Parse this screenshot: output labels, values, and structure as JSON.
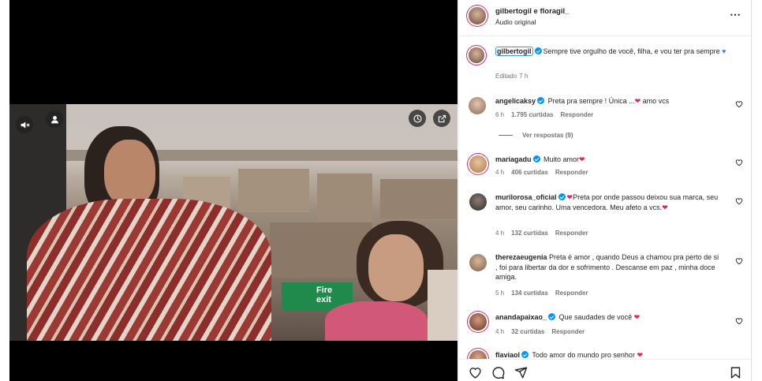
{
  "post": {
    "author_line": "gilbertogil e floragil_",
    "audio": "Áudio original",
    "more": "⋯"
  },
  "caption": {
    "user": "gilbertogil",
    "text": "Sempre tive orgulho de você, filha, e vou ter pra sempre",
    "edited": "Editado",
    "time": "7 h"
  },
  "video": {
    "sign_text_1": "Fire",
    "sign_text_2": "exit"
  },
  "comments": [
    {
      "user": "angelicaksy",
      "text": "Preta pra sempre ! Única ...",
      "text_after": "amo vcs",
      "time": "6 h",
      "likes": "1.795 curtidas",
      "reply": "Responder",
      "view_replies": "Ver respostas (9)"
    },
    {
      "user": "mariagadu",
      "text": "Muito amor",
      "text_after": "",
      "time": "4 h",
      "likes": "406 curtidas",
      "reply": "Responder"
    },
    {
      "user": "murilorosa_oficial",
      "text": "Preta por onde passou deixou sua marca, seu amor, seu carinho. Uma vencedora. Meu afeto a vcs.",
      "text_after": "",
      "time": "4 h",
      "likes": "132 curtidas",
      "reply": "Responder"
    },
    {
      "user": "therezaeugenia",
      "text": "Preta é amor , quando Deus a chamou pra perto de si , foi para libertar da dor e sofrimento . Descanse em paz , minha doce amiga.",
      "text_after": "",
      "time": "5 h",
      "likes": "134 curtidas",
      "reply": "Responder"
    },
    {
      "user": "anandapaixao_",
      "text": "Que saudades de você",
      "text_after": "",
      "time": "4 h",
      "likes": "32 curtidas",
      "reply": "Responder"
    },
    {
      "user": "flaviaol",
      "text": "Todo amor do mundo pro senhor",
      "text_after": "",
      "time": "",
      "likes": "",
      "reply": ""
    }
  ],
  "colors": {
    "verified": "#0095f6",
    "heart": "#e0245e",
    "meta": "#737373",
    "sign": "#1f8a4c"
  }
}
